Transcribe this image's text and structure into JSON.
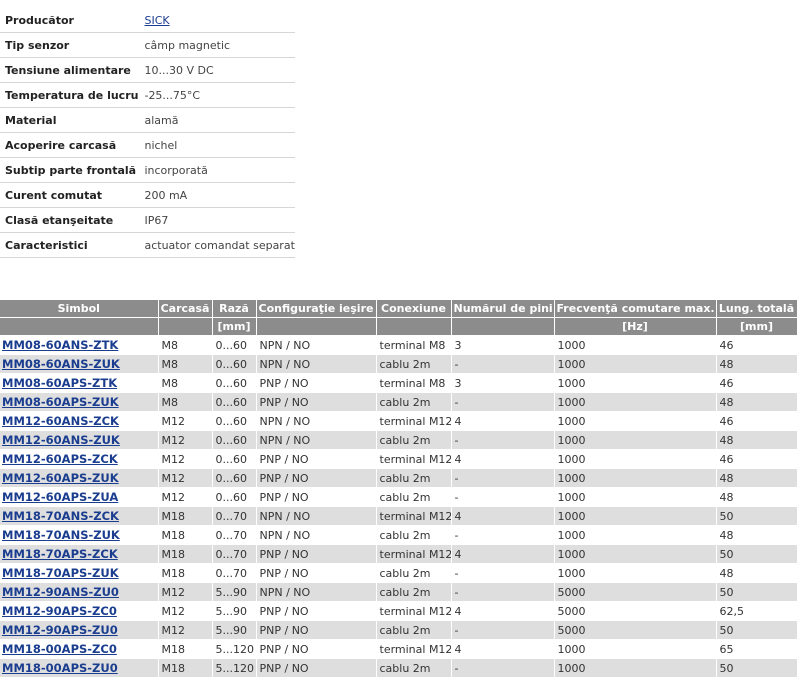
{
  "specs": [
    {
      "label": "Producător",
      "value": "SICK",
      "link": true
    },
    {
      "label": "Tip senzor",
      "value": "câmp magnetic"
    },
    {
      "label": "Tensiune alimentare",
      "value": "10...30 V DC"
    },
    {
      "label": "Temperatura de lucru",
      "value": "-25...75°C"
    },
    {
      "label": "Material",
      "value": "alamă"
    },
    {
      "label": "Acoperire carcasă",
      "value": "nichel"
    },
    {
      "label": "Subtip parte frontală",
      "value": "incorporată"
    },
    {
      "label": "Curent comutat",
      "value": "200 mA"
    },
    {
      "label": "Clasă etanşeitate",
      "value": "IP67"
    },
    {
      "label": "Caracteristici",
      "value": "actuator comandat separat"
    }
  ],
  "table": {
    "headers": [
      "Simbol",
      "Carcasă",
      "Rază",
      "Configuraţie ieşire",
      "Conexiune",
      "Numărul de pini",
      "Frecvenţă comutare max.",
      "Lung. totală"
    ],
    "units": [
      "",
      "",
      "[mm]",
      "",
      "",
      "",
      "[Hz]",
      "[mm]"
    ],
    "rows": [
      [
        "MM08-60ANS-ZTK",
        "M8",
        "0...60",
        "NPN / NO",
        "terminal M8",
        "3",
        "1000",
        "46"
      ],
      [
        "MM08-60ANS-ZUK",
        "M8",
        "0...60",
        "NPN / NO",
        "cablu 2m",
        "-",
        "1000",
        "48"
      ],
      [
        "MM08-60APS-ZTK",
        "M8",
        "0...60",
        "PNP / NO",
        "terminal M8",
        "3",
        "1000",
        "46"
      ],
      [
        "MM08-60APS-ZUK",
        "M8",
        "0...60",
        "PNP / NO",
        "cablu 2m",
        "-",
        "1000",
        "48"
      ],
      [
        "MM12-60ANS-ZCK",
        "M12",
        "0...60",
        "NPN / NO",
        "terminal M12",
        "4",
        "1000",
        "46"
      ],
      [
        "MM12-60ANS-ZUK",
        "M12",
        "0...60",
        "NPN / NO",
        "cablu 2m",
        "-",
        "1000",
        "48"
      ],
      [
        "MM12-60APS-ZCK",
        "M12",
        "0...60",
        "PNP / NO",
        "terminal M12",
        "4",
        "1000",
        "46"
      ],
      [
        "MM12-60APS-ZUK",
        "M12",
        "0...60",
        "PNP / NO",
        "cablu 2m",
        "-",
        "1000",
        "48"
      ],
      [
        "MM12-60APS-ZUA",
        "M12",
        "0...60",
        "PNP / NO",
        "cablu 2m",
        "-",
        "1000",
        "48"
      ],
      [
        "MM18-70ANS-ZCK",
        "M18",
        "0...70",
        "NPN / NO",
        "terminal M12",
        "4",
        "1000",
        "50"
      ],
      [
        "MM18-70ANS-ZUK",
        "M18",
        "0...70",
        "NPN / NO",
        "cablu 2m",
        "-",
        "1000",
        "48"
      ],
      [
        "MM18-70APS-ZCK",
        "M18",
        "0...70",
        "PNP / NO",
        "terminal M12",
        "4",
        "1000",
        "50"
      ],
      [
        "MM18-70APS-ZUK",
        "M18",
        "0...70",
        "PNP / NO",
        "cablu 2m",
        "-",
        "1000",
        "48"
      ],
      [
        "MM12-90ANS-ZU0",
        "M12",
        "5...90",
        "NPN / NO",
        "cablu 2m",
        "-",
        "5000",
        "50"
      ],
      [
        "MM12-90APS-ZC0",
        "M12",
        "5...90",
        "PNP / NO",
        "terminal M12",
        "4",
        "5000",
        "62,5"
      ],
      [
        "MM12-90APS-ZU0",
        "M12",
        "5...90",
        "PNP / NO",
        "cablu 2m",
        "-",
        "5000",
        "50"
      ],
      [
        "MM18-00APS-ZC0",
        "M18",
        "5...120",
        "PNP / NO",
        "terminal M12",
        "4",
        "1000",
        "65"
      ],
      [
        "MM18-00APS-ZU0",
        "M18",
        "5...120",
        "PNP / NO",
        "cablu 2m",
        "-",
        "1000",
        "50"
      ]
    ]
  },
  "colors": {
    "header_bg": "#8c8c8c",
    "row_alt": "#dedede",
    "link": "#1a3d8f"
  }
}
